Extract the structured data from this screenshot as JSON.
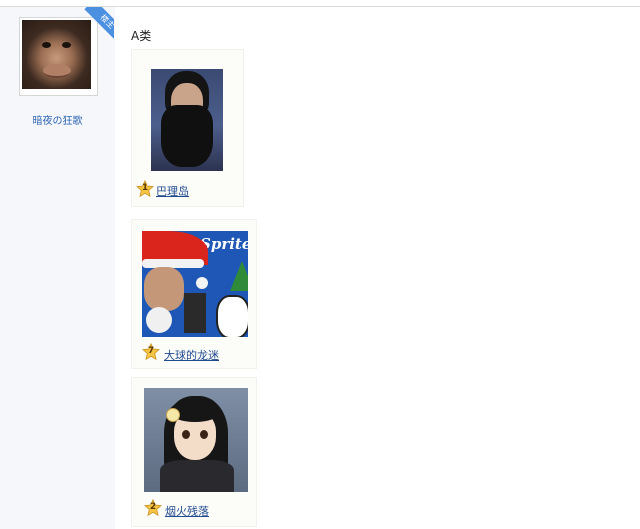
{
  "author": {
    "name": "暗夜の狂歌",
    "badge": "楼主",
    "avatar_icon": "chimpanzee-avatar"
  },
  "section": {
    "title": "A类"
  },
  "entries": [
    {
      "rank": "1",
      "name": "巴理岛",
      "photo_icon": "man-with-beard-photo"
    },
    {
      "rank": "7",
      "name": "大球的龙迷",
      "photo_icon": "sprite-christmas-collage-photo",
      "brand_text": "Sprite"
    },
    {
      "rank": "2",
      "name": "烟火残落",
      "photo_icon": "anime-girl-photo"
    }
  ],
  "colors": {
    "link": "#1f4a8f",
    "badge": "#4b8fe0",
    "sidebar": "#f5f7fa"
  }
}
